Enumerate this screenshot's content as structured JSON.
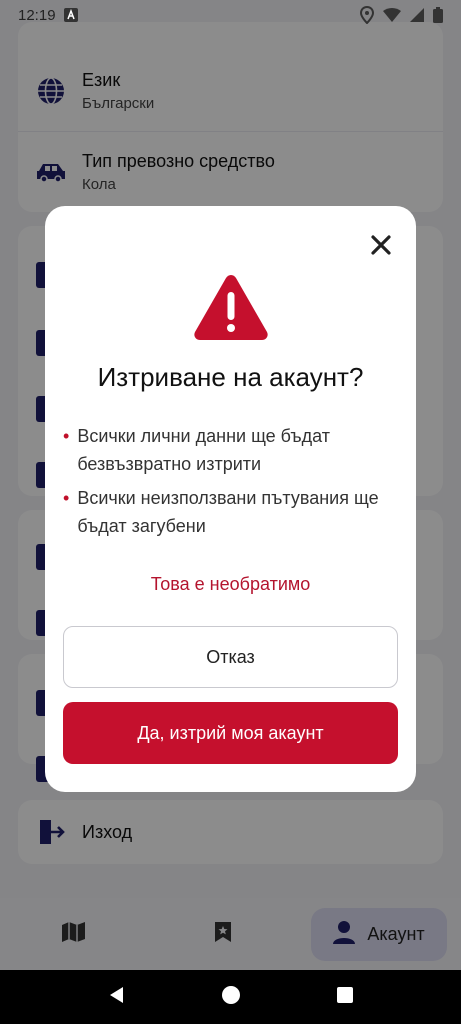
{
  "status_bar": {
    "time": "12:19",
    "icons": [
      "notification-a-icon",
      "location-icon",
      "wifi-icon",
      "signal-icon",
      "battery-icon"
    ]
  },
  "settings": {
    "language": {
      "title": "Език",
      "value": "Български",
      "icon": "globe-icon"
    },
    "vehicle": {
      "title": "Тип превозно средство",
      "value": "Кола",
      "icon": "car-icon"
    },
    "logout": {
      "label": "Изход",
      "icon": "logout-icon"
    }
  },
  "bottom_nav": {
    "items": [
      {
        "icon": "map-icon",
        "label": ""
      },
      {
        "icon": "bookmark-icon",
        "label": ""
      },
      {
        "icon": "person-icon",
        "label": "Акаунт",
        "active": true
      }
    ]
  },
  "dialog": {
    "title": "Изтриване на акаунт?",
    "bullets": [
      "Всички лични данни ще бъдат безвъзвратно изтрити",
      "Всички неизползвани пътувания ще бъдат загубени"
    ],
    "warning_text": "Това е необратимо",
    "cancel_label": "Отказ",
    "confirm_label": "Да, изтрий моя акаунт"
  },
  "colors": {
    "accent": "#c5102d",
    "navy": "#1f1f6b",
    "active_tab_bg": "#dcdcf2"
  }
}
